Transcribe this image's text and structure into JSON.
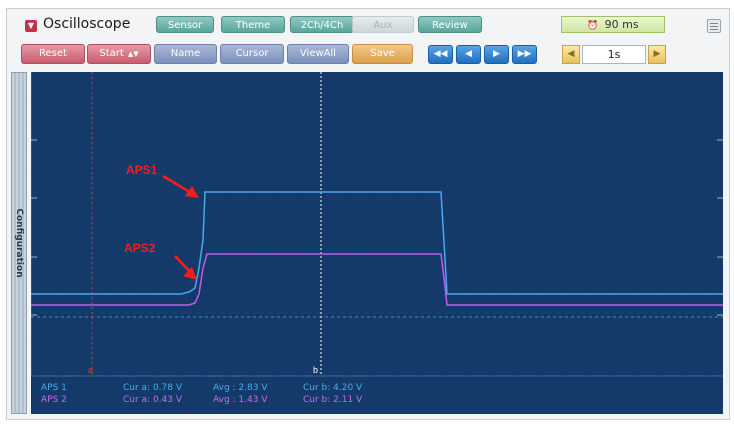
{
  "app": {
    "title": "Oscilloscope",
    "menu_icon": "hamburger-menu-icon",
    "app_icon": "dropdown-arrow-icon"
  },
  "tabs": [
    {
      "label": "Sensor",
      "enabled": true
    },
    {
      "label": "Theme",
      "enabled": true
    },
    {
      "label": "2Ch/4Ch",
      "enabled": true
    },
    {
      "label": "Aux",
      "enabled": false
    },
    {
      "label": "Review",
      "enabled": true
    }
  ],
  "status": {
    "sample_time": "90 ms",
    "icon": "clock-icon"
  },
  "toolbar": {
    "reset": "Reset",
    "start": "Start",
    "name": "Name",
    "cursor": "Cursor",
    "viewall": "ViewAll",
    "save": "Save"
  },
  "navigation": {
    "first": "skip-to-start-icon",
    "prev": "step-back-icon",
    "next": "step-forward-icon",
    "last": "skip-to-end-icon"
  },
  "timescale": {
    "value": "1s",
    "decrease_icon": "triangle-left-icon",
    "increase_icon": "triangle-right-icon"
  },
  "side_panel": {
    "label": "Configuration"
  },
  "colors": {
    "screen_bg": "#143a6a",
    "channel1": "#4aa6ee",
    "channel2": "#c45ae6",
    "annotation": "#ff1a1a",
    "cursor_a": "#d23c3c",
    "cursor_b": "#ffffff"
  },
  "waveform": {
    "annotations": {
      "aps1": "APS1",
      "aps2": "APS2"
    },
    "cursor_a_label": "a",
    "cursor_b_label": "b"
  },
  "readouts": [
    {
      "channel": "APS 1",
      "cur_a": "Cur a: 0.78 V",
      "avg": "Avg : 2.83 V",
      "cur_b": "Cur b: 4.20 V"
    },
    {
      "channel": "APS 2",
      "cur_a": "Cur a: 0.43 V",
      "avg": "Avg : 1.43 V",
      "cur_b": "Cur b: 2.11 V"
    }
  ]
}
